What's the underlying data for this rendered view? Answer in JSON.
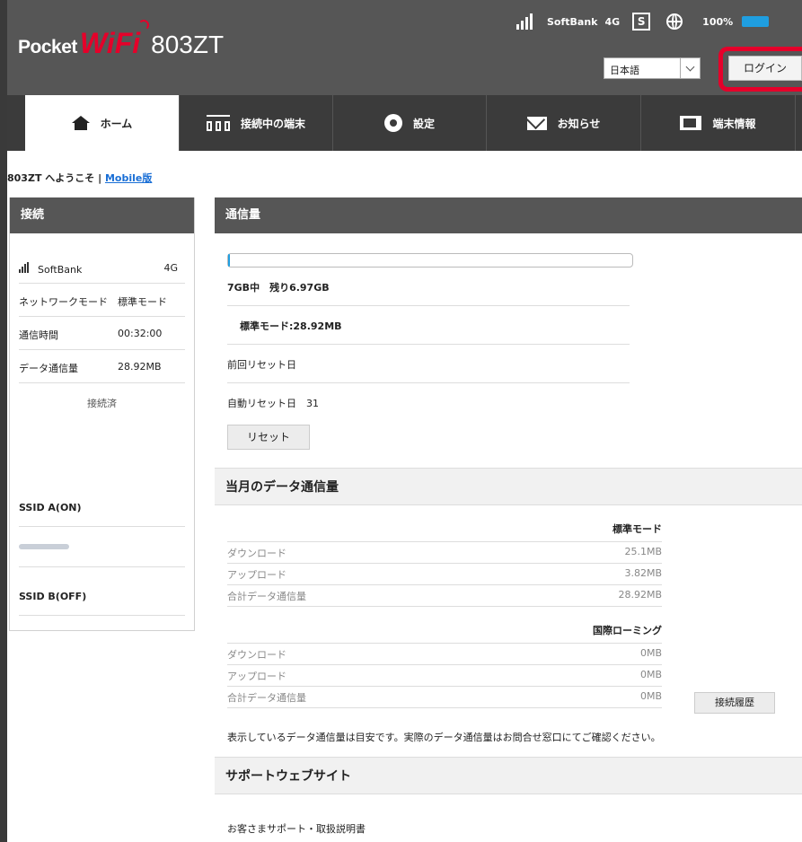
{
  "header": {
    "logo_pocket": "Pocket",
    "logo_wifi": "WiFi",
    "logo_model": "803ZT",
    "carrier": "SoftBank",
    "network_type": "4G",
    "sim_label": "S",
    "battery": "100%",
    "battery_color": "#1f9ee0",
    "language_value": "日本語",
    "login_label": "ログイン",
    "highlight_color": "#e5002a"
  },
  "nav": {
    "items": [
      {
        "label": "ホーム",
        "icon": "home-icon"
      },
      {
        "label": "接続中の端末",
        "icon": "devices-icon"
      },
      {
        "label": "設定",
        "icon": "gear-icon"
      },
      {
        "label": "お知らせ",
        "icon": "mail-icon"
      },
      {
        "label": "端末情報",
        "icon": "device-info-icon"
      }
    ]
  },
  "welcome": {
    "text": "803ZT へようこそ | ",
    "mobile_link": "Mobile版"
  },
  "connection": {
    "title": "接続",
    "carrier": "SoftBank",
    "network_type": "4G",
    "network_mode_label": "ネットワークモード",
    "network_mode_value": "標準モード",
    "time_label": "通信時間",
    "time_value": "00:32:00",
    "data_label": "データ通信量",
    "data_value": "28.92MB",
    "status": "接続済",
    "ssid_a": "SSID A(ON)",
    "ssid_b": "SSID B(OFF)"
  },
  "usage": {
    "title": "通信量",
    "progress_percent": 0.4,
    "remaining": "7GB中　残り6.97GB",
    "standard_mode": "標準モード:28.92MB",
    "last_reset": "前回リセット日",
    "auto_reset": "自動リセット日　31",
    "reset_button": "リセット"
  },
  "monthly": {
    "title": "当月のデータ通信量",
    "standard": {
      "header": "標準モード",
      "rows": [
        {
          "label": "ダウンロード",
          "value": "25.1MB"
        },
        {
          "label": "アップロード",
          "value": "3.82MB"
        },
        {
          "label": "合計データ通信量",
          "value": "28.92MB"
        }
      ]
    },
    "roaming": {
      "header": "国際ローミング",
      "rows": [
        {
          "label": "ダウンロード",
          "value": "0MB"
        },
        {
          "label": "アップロード",
          "value": "0MB"
        },
        {
          "label": "合計データ通信量",
          "value": "0MB"
        }
      ]
    },
    "history_button": "接続履歴",
    "note": "表示しているデータ通信量は目安です。実際のデータ通信量はお問合せ窓口にてご確認ください。"
  },
  "support": {
    "title": "サポートウェブサイト",
    "link": "お客さまサポート・取扱説明書"
  }
}
